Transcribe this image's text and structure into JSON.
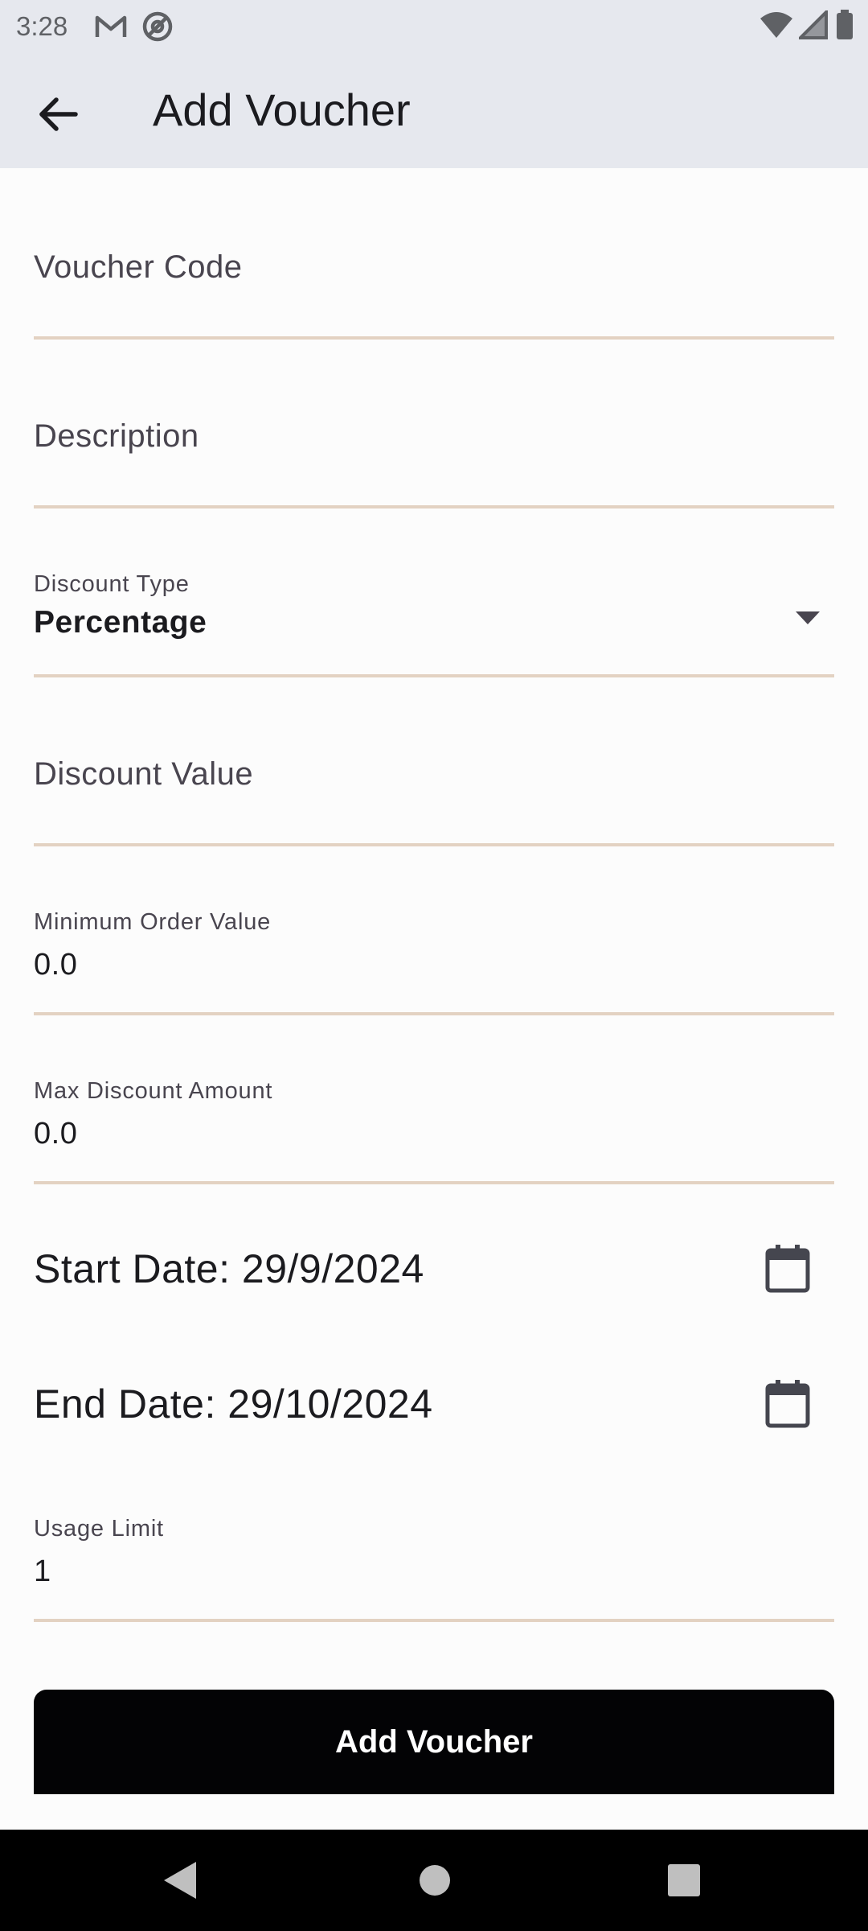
{
  "status_bar": {
    "time": "3:28",
    "left_icons": [
      "gmail-icon",
      "at-sign-icon"
    ],
    "right_icons": [
      "wifi-icon",
      "signal-icon",
      "battery-icon"
    ]
  },
  "app_bar": {
    "title": "Add Voucher",
    "back_icon": "arrow-left-icon"
  },
  "form": {
    "voucher_code": {
      "placeholder": "Voucher Code",
      "value": ""
    },
    "description": {
      "placeholder": "Description",
      "value": ""
    },
    "discount_type": {
      "label": "Discount Type",
      "value": "Percentage"
    },
    "discount_value": {
      "placeholder": "Discount Value",
      "value": ""
    },
    "min_order_value": {
      "label": "Minimum Order Value",
      "value": "0.0"
    },
    "max_discount": {
      "label": "Max Discount Amount",
      "value": "0.0"
    },
    "start_date": {
      "text": "Start Date: 29/9/2024",
      "icon": "calendar-icon"
    },
    "end_date": {
      "text": "End Date: 29/10/2024",
      "icon": "calendar-icon"
    },
    "usage_limit": {
      "label": "Usage Limit",
      "value": "1"
    },
    "submit_label": "Add Voucher"
  },
  "colors": {
    "app_bar": "#e6e8ee",
    "underline": "#e3d2c2",
    "button": "#030305",
    "background": "#fcfcfc"
  },
  "nav_bar": {
    "buttons": [
      "back-triangle-icon",
      "home-circle-icon",
      "recents-square-icon"
    ]
  }
}
